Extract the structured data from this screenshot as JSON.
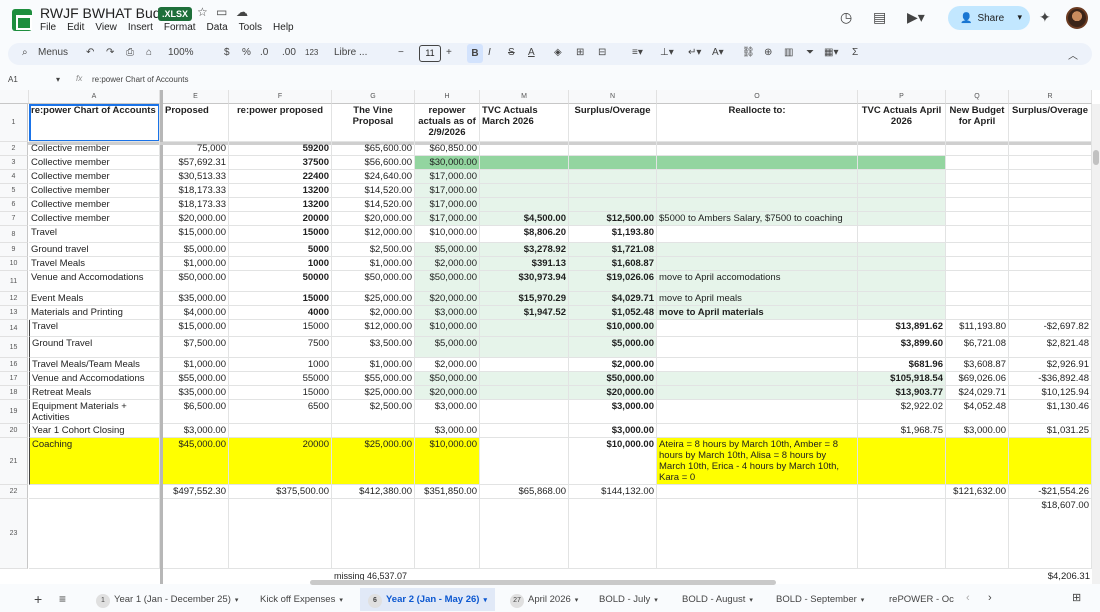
{
  "app": {
    "title": "RWJF BWHAT Budget",
    "badge": ".XLSX",
    "menu": [
      "File",
      "Edit",
      "View",
      "Insert",
      "Format",
      "Data",
      "Tools",
      "Help"
    ],
    "share_label": "Share"
  },
  "toolbar": {
    "search_label": "Menus",
    "zoom": "100%",
    "currency": "$",
    "percent": "%",
    "dec_less": ".0",
    "dec_more": ".00",
    "num_format": "123",
    "font": "Libre ...",
    "font_size": "11",
    "bold": "B",
    "italic": "I",
    "strike": "S",
    "text_color": "A",
    "sigma": "Σ"
  },
  "formula": {
    "cell_ref": "A1",
    "fx": "fx",
    "value": "re:power Chart of Accounts"
  },
  "columns": [
    "A",
    "E",
    "F",
    "G",
    "H",
    "M",
    "N",
    "O",
    "P",
    "Q",
    "R"
  ],
  "row_numbers": [
    "1",
    "2",
    "3",
    "4",
    "5",
    "6",
    "7",
    "8",
    "9",
    "10",
    "11",
    "12",
    "13",
    "14",
    "15",
    "16",
    "17",
    "18",
    "19",
    "20",
    "21",
    "22",
    "23"
  ],
  "headers": {
    "A": "re:power Chart of Accounts",
    "E": "Proposed",
    "F": "re:power proposed",
    "G": "The Vine Proposal",
    "H": "repower actuals as of 2/9/2026",
    "M": "TVC Actuals March 2026",
    "N": "Surplus/Overage",
    "O": "Reallocte to:",
    "P": "TVC Actuals April 2026",
    "Q": "New Budget for April",
    "R": "Surplus/Overage"
  },
  "rows": [
    {
      "A": "Collective member",
      "E": "75,000",
      "F": "59200",
      "G": "$65,600.00",
      "H": "$60,850.00",
      "M": "",
      "N": "",
      "O": "",
      "P": "",
      "Q": "",
      "R": ""
    },
    {
      "A": "Collective member",
      "E": "$57,692.31",
      "F": "37500",
      "G": "$56,600.00",
      "H": "$30,000.00",
      "M": "",
      "N": "",
      "O": "",
      "P": "",
      "Q": "",
      "R": ""
    },
    {
      "A": "Collective member",
      "E": "$30,513.33",
      "F": "22400",
      "G": "$24,640.00",
      "H": "$17,000.00",
      "M": "",
      "N": "",
      "O": "",
      "P": "",
      "Q": "",
      "R": ""
    },
    {
      "A": "Collective member",
      "E": "$18,173.33",
      "F": "13200",
      "G": "$14,520.00",
      "H": "$17,000.00",
      "M": "",
      "N": "",
      "O": "",
      "P": "",
      "Q": "",
      "R": ""
    },
    {
      "A": "Collective member",
      "E": "$18,173.33",
      "F": "13200",
      "G": "$14,520.00",
      "H": "$17,000.00",
      "M": "",
      "N": "",
      "O": "",
      "P": "",
      "Q": "",
      "R": ""
    },
    {
      "A": "Collective member",
      "E": "$20,000.00",
      "F": "20000",
      "G": "$20,000.00",
      "H": "$17,000.00",
      "M": "$4,500.00",
      "N": "$12,500.00",
      "O": "$5000 to Ambers Salary, $7500 to coaching",
      "P": "",
      "Q": "",
      "R": ""
    },
    {
      "A": "Travel",
      "E": "$15,000.00",
      "F": "15000",
      "G": "$12,000.00",
      "H": "$10,000.00",
      "M": "$8,806.20",
      "N": "$1,193.80",
      "O": "",
      "P": "",
      "Q": "",
      "R": ""
    },
    {
      "A": "Ground travel",
      "E": "$5,000.00",
      "F": "5000",
      "G": "$2,500.00",
      "H": "$5,000.00",
      "M": "$3,278.92",
      "N": "$1,721.08",
      "O": "",
      "P": "",
      "Q": "",
      "R": ""
    },
    {
      "A": "Travel Meals",
      "E": "$1,000.00",
      "F": "1000",
      "G": "$1,000.00",
      "H": "$2,000.00",
      "M": "$391.13",
      "N": "$1,608.87",
      "O": "",
      "P": "",
      "Q": "",
      "R": ""
    },
    {
      "A": "Venue and Accomodations",
      "E": "$50,000.00",
      "F": "50000",
      "G": "$50,000.00",
      "H": "$50,000.00",
      "M": "$30,973.94",
      "N": "$19,026.06",
      "O": "move to April accomodations",
      "P": "",
      "Q": "",
      "R": ""
    },
    {
      "A": "Event Meals",
      "E": "$35,000.00",
      "F": "15000",
      "G": "$25,000.00",
      "H": "$20,000.00",
      "M": "$15,970.29",
      "N": "$4,029.71",
      "O": "move to April meals",
      "P": "",
      "Q": "",
      "R": ""
    },
    {
      "A": "Materials and Printing",
      "E": "$4,000.00",
      "F": "4000",
      "G": "$2,000.00",
      "H": "$3,000.00",
      "M": "$1,947.52",
      "N": "$1,052.48",
      "O": "move to April materials",
      "P": "",
      "Q": "",
      "R": ""
    },
    {
      "A": "Travel",
      "E": "$15,000.00",
      "F": "15000",
      "G": "$12,000.00",
      "H": "$10,000.00",
      "M": "",
      "N": "$10,000.00",
      "O": "",
      "P": "$13,891.62",
      "Q": "$11,193.80",
      "R": "-$2,697.82"
    },
    {
      "A": "Ground Travel",
      "E": "$7,500.00",
      "F": "7500",
      "G": "$3,500.00",
      "H": "$5,000.00",
      "M": "",
      "N": "$5,000.00",
      "O": "",
      "P": "$3,899.60",
      "Q": "$6,721.08",
      "R": "$2,821.48"
    },
    {
      "A": "Travel Meals/Team Meals",
      "E": "$1,000.00",
      "F": "1000",
      "G": "$1,000.00",
      "H": "$2,000.00",
      "M": "",
      "N": "$2,000.00",
      "O": "",
      "P": "$681.96",
      "Q": "$3,608.87",
      "R": "$2,926.91"
    },
    {
      "A": "Venue and Accomodations",
      "E": "$55,000.00",
      "F": "55000",
      "G": "$55,000.00",
      "H": "$50,000.00",
      "M": "",
      "N": "$50,000.00",
      "O": "",
      "P": "$105,918.54",
      "Q": "$69,026.06",
      "R": "-$36,892.48"
    },
    {
      "A": "Retreat Meals",
      "E": "$35,000.00",
      "F": "15000",
      "G": "$25,000.00",
      "H": "$20,000.00",
      "M": "",
      "N": "$20,000.00",
      "O": "",
      "P": "$13,903.77",
      "Q": "$24,029.71",
      "R": "$10,125.94"
    },
    {
      "A": "Equipment Materials + Activities",
      "E": "$6,500.00",
      "F": "6500",
      "G": "$2,500.00",
      "H": "$3,000.00",
      "M": "",
      "N": "$3,000.00",
      "O": "",
      "P": "$2,922.02",
      "Q": "$4,052.48",
      "R": "$1,130.46"
    },
    {
      "A": "Year 1 Cohort Closing",
      "E": "$3,000.00",
      "F": "",
      "G": "",
      "H": "$3,000.00",
      "M": "",
      "N": "$3,000.00",
      "O": "",
      "P": "$1,968.75",
      "Q": "$3,000.00",
      "R": "$1,031.25"
    },
    {
      "A": "Coaching",
      "E": "$45,000.00",
      "F": "20000",
      "G": "$25,000.00",
      "H": "$10,000.00",
      "M": "",
      "N": "$10,000.00",
      "O": "Ateira = 8 hours by March 10th, Amber = 8 hours by March 10th, Alisa = 8 hours by March 10th, Erica - 4 hours by March 10th, Kara = 0",
      "P": "",
      "Q": "",
      "R": ""
    },
    {
      "A": "",
      "E": "$497,552.30",
      "F": "$375,500.00",
      "G": "$412,380.00",
      "H": "$351,850.00",
      "M": "$65,868.00",
      "N": "$144,132.00",
      "O": "",
      "P": "",
      "Q": "$121,632.00",
      "R": "-$21,554.26"
    },
    {
      "A": "",
      "E": "",
      "F": "",
      "G": "",
      "H": "",
      "M": "",
      "N": "",
      "O": "",
      "P": "",
      "Q": "",
      "R": "$18,607.00"
    }
  ],
  "overflow": {
    "missing": "missing 46,537.07",
    "r_bottom": "$4,206.31"
  },
  "sheets": [
    {
      "num": "1",
      "label": "Year 1 (Jan - December 25)"
    },
    {
      "num": "",
      "label": "Kick off Expenses"
    },
    {
      "num": "6",
      "label": "Year 2 (Jan - May 26)"
    },
    {
      "num": "27",
      "label": "April 2026"
    },
    {
      "num": "",
      "label": "BOLD - July"
    },
    {
      "num": "",
      "label": "BOLD - August"
    },
    {
      "num": "",
      "label": "BOLD - September"
    },
    {
      "num": "",
      "label": "rePOWER - Oc"
    }
  ],
  "colors": {
    "yellow": "#ffff00",
    "green": "#93d5a0",
    "light_green": "#e6f4ea",
    "accent": "#1a73e8"
  }
}
